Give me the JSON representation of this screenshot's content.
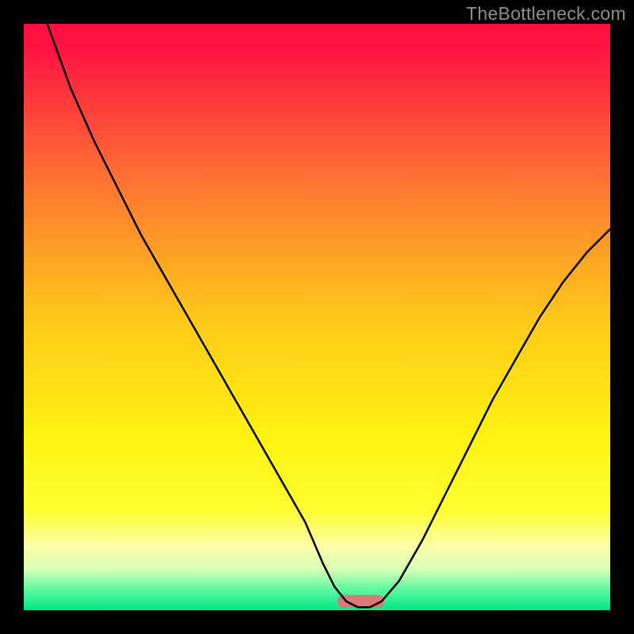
{
  "watermark": "TheBottleneck.com",
  "chart_data": {
    "type": "line",
    "title": "",
    "xlabel": "",
    "ylabel": "",
    "xlim": [
      0,
      100
    ],
    "ylim": [
      0,
      100
    ],
    "background_gradient": {
      "stops": [
        {
          "offset": 0.0,
          "color": "#ff1040"
        },
        {
          "offset": 0.04,
          "color": "#ff1342"
        },
        {
          "offset": 0.26,
          "color": "#ff7032"
        },
        {
          "offset": 0.5,
          "color": "#ffc81a"
        },
        {
          "offset": 0.7,
          "color": "#fff210"
        },
        {
          "offset": 0.83,
          "color": "#fffe30"
        },
        {
          "offset": 0.89,
          "color": "#fcffa8"
        },
        {
          "offset": 0.93,
          "color": "#d8ffb8"
        },
        {
          "offset": 0.965,
          "color": "#5cf8a0"
        },
        {
          "offset": 1.0,
          "color": "#00e884"
        }
      ]
    },
    "series": [
      {
        "name": "bottleneck-curve",
        "x": [
          0,
          4,
          8,
          12,
          16,
          20,
          24,
          28,
          32,
          36,
          40,
          44,
          48,
          51,
          53,
          55,
          57,
          59,
          61,
          64,
          68,
          72,
          76,
          80,
          84,
          88,
          92,
          96,
          100
        ],
        "y": [
          112,
          100,
          89,
          80,
          72,
          64,
          57,
          50,
          43,
          36,
          29,
          22,
          15,
          8,
          4,
          1.5,
          0.5,
          0.5,
          1.5,
          5,
          12,
          20,
          28,
          36,
          43,
          50,
          56,
          61,
          65
        ]
      }
    ],
    "marker": {
      "name": "optimal-pill",
      "x": 57.5,
      "y": 1.5,
      "width": 8,
      "height": 2.2,
      "color": "#d97a78"
    }
  }
}
